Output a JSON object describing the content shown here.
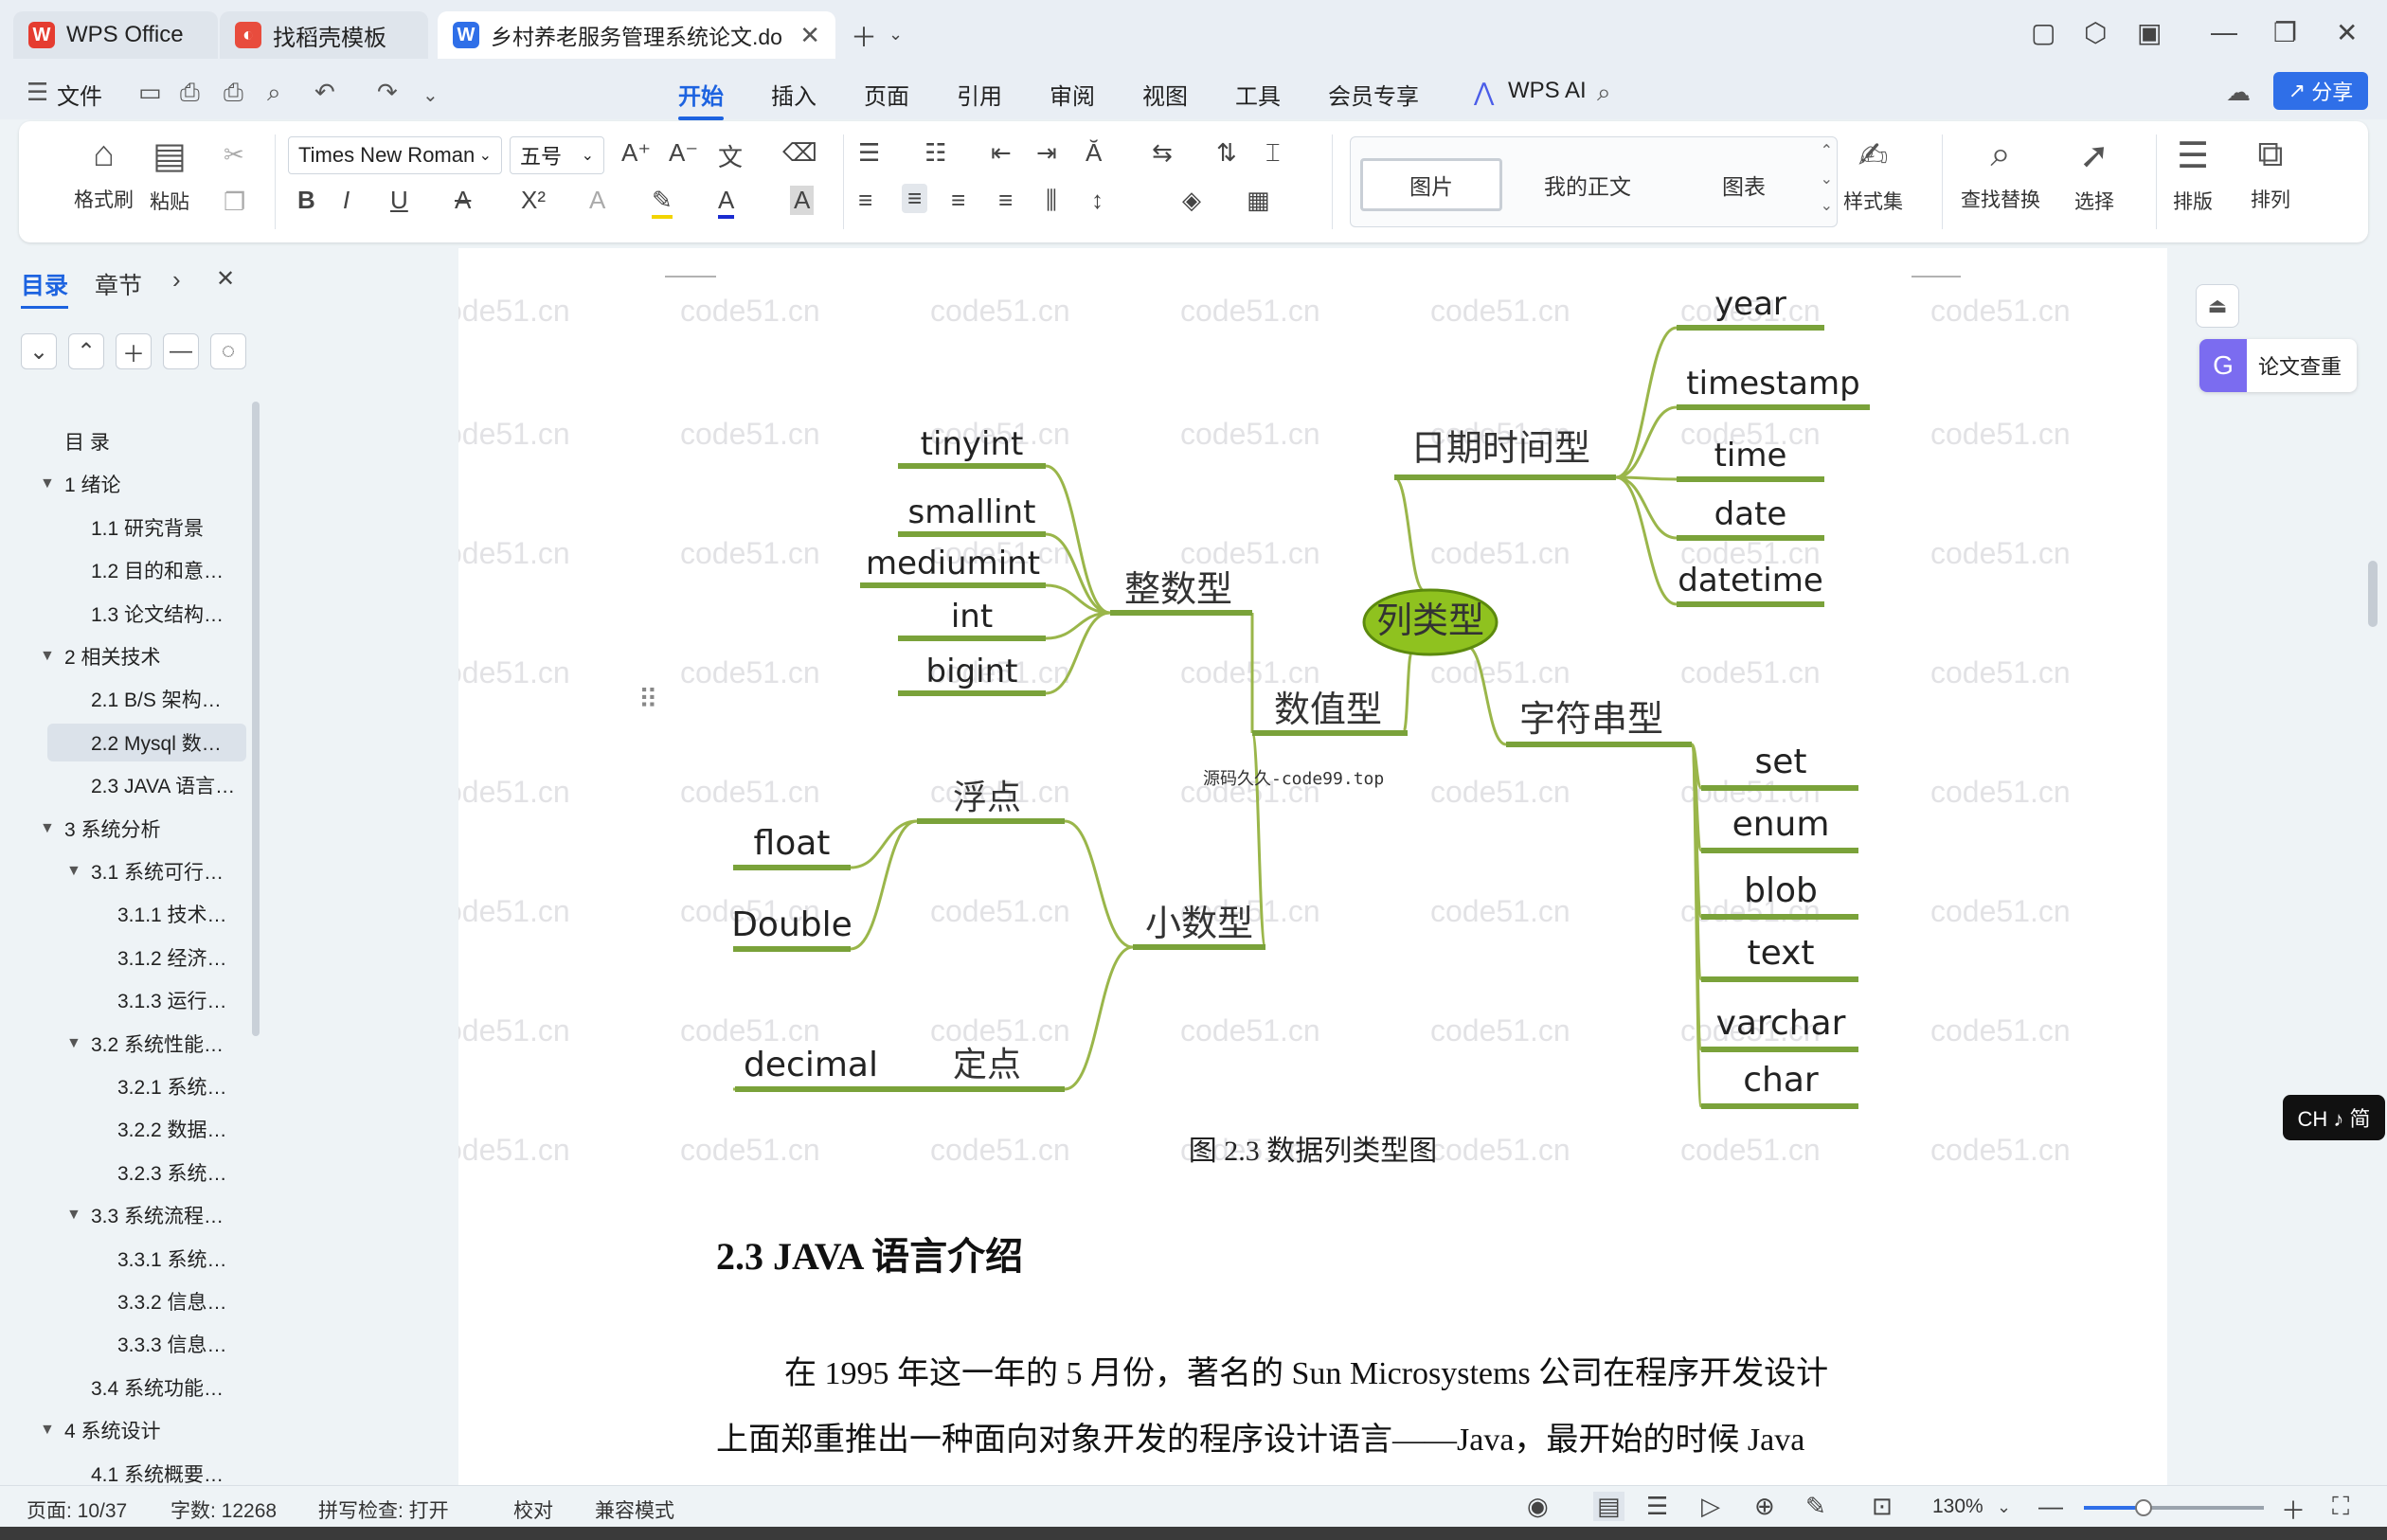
{
  "tabs": [
    {
      "label": "WPS Office",
      "icon": "wps-logo-icon"
    },
    {
      "label": "找稻壳模板",
      "icon": "docer-icon"
    },
    {
      "label": "乡村养老服务管理系统论文.do",
      "icon": "word-doc-icon"
    }
  ],
  "menu": {
    "file": "文件",
    "items": [
      "开始",
      "插入",
      "页面",
      "引用",
      "审阅",
      "视图",
      "工具",
      "会员专享"
    ],
    "active": "开始",
    "wps_ai": "WPS AI",
    "share": "分享"
  },
  "ribbon": {
    "format_painter": "格式刷",
    "paste": "粘贴",
    "font_name": "Times New Roman",
    "font_size": "五号",
    "styles": [
      "图片",
      "我的正文",
      "图表"
    ],
    "style_set": "样式集",
    "find_replace": "查找替换",
    "select": "选择",
    "layout": "排版",
    "arrange": "排列"
  },
  "nav": {
    "tabs": [
      "目录",
      "章节"
    ],
    "toc": [
      {
        "label": "目 录",
        "level": 0
      },
      {
        "label": "1 绪论",
        "level": 1
      },
      {
        "label": "1.1 研究背景",
        "level": 2
      },
      {
        "label": "1.2 目的和意…",
        "level": 2
      },
      {
        "label": "1.3 论文结构…",
        "level": 2
      },
      {
        "label": "2 相关技术",
        "level": 1
      },
      {
        "label": "2.1 B/S 架构…",
        "level": 2
      },
      {
        "label": "2.2 Mysql 数…",
        "level": 2
      },
      {
        "label": "2.3 JAVA 语言…",
        "level": 2
      },
      {
        "label": "3 系统分析",
        "level": 1
      },
      {
        "label": "3.1 系统可行…",
        "level": 2
      },
      {
        "label": "3.1.1 技术…",
        "level": 3
      },
      {
        "label": "3.1.2 经济…",
        "level": 3
      },
      {
        "label": "3.1.3 运行…",
        "level": 3
      },
      {
        "label": "3.2 系统性能…",
        "level": 2
      },
      {
        "label": "3.2.1 系统…",
        "level": 3
      },
      {
        "label": "3.2.2 数据…",
        "level": 3
      },
      {
        "label": "3.2.3 系统…",
        "level": 3
      },
      {
        "label": "3.3 系统流程…",
        "level": 2
      },
      {
        "label": "3.3.1 系统…",
        "level": 3
      },
      {
        "label": "3.3.2 信息…",
        "level": 3
      },
      {
        "label": "3.3.3 信息…",
        "level": 3
      },
      {
        "label": "3.4 系统功能…",
        "level": 2
      },
      {
        "label": "4 系统设计",
        "level": 1
      },
      {
        "label": "4.1 系统概要…",
        "level": 2
      }
    ],
    "selected": "2.2 Mysql 数…"
  },
  "mindmap": {
    "center": "列类型",
    "numeric": "数值型",
    "integer": "整数型",
    "integer_items": [
      "tinyint",
      "smallint",
      "mediumint",
      "int",
      "bigint"
    ],
    "decimal_group": "小数型",
    "float_point": "浮点",
    "float_items": [
      "float",
      "Double"
    ],
    "fixed_point": "定点",
    "fixed_items": [
      "decimal"
    ],
    "datetime": "日期时间型",
    "datetime_items": [
      "year",
      "timestamp",
      "time",
      "date",
      "datetime"
    ],
    "string": "字符串型",
    "string_items": [
      "set",
      "enum",
      "blob",
      "text",
      "varchar",
      "char"
    ],
    "source_note": "源码久久-code99.top",
    "colors": {
      "branch": "#9ab64a",
      "center_fill": "#8fc21f"
    }
  },
  "document": {
    "caption": "图 2.3 数据列类型图",
    "heading": "2.3 JAVA 语言介绍",
    "para_line1": "在 1995 年这一年的 5 月份，著名的 Sun Microsystems 公司在程序开发设计",
    "para_line2": "上面郑重推出一种面向对象开发的程序设计语言——Java，最开始的时候 Java",
    "watermark": "code51.cn"
  },
  "side": {
    "paper_check": "论文查重",
    "ime": "CH ♪ 简"
  },
  "status": {
    "page": "页面: 10/37",
    "words": "字数: 12268",
    "spell": "拼写检查: 打开",
    "proof": "校对",
    "compat": "兼容模式",
    "zoom": "130%",
    "zoom_fraction": 0.33
  }
}
